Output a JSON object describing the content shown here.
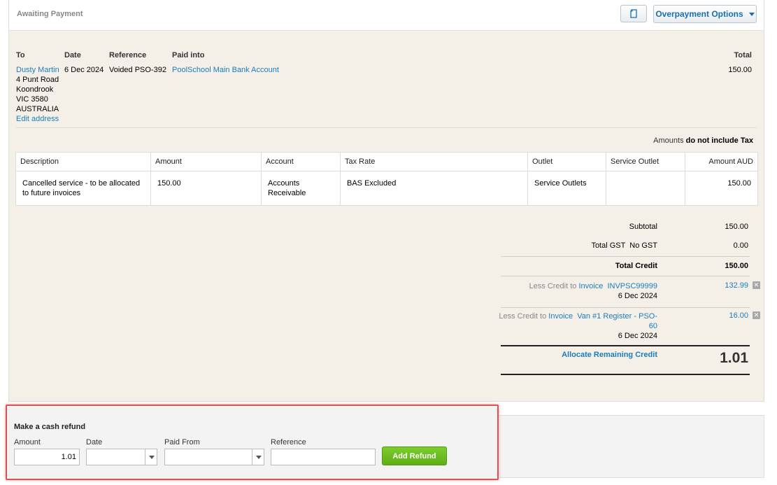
{
  "header": {
    "status": "Awaiting Payment",
    "overpayment_options_label": "Overpayment Options"
  },
  "details": {
    "labels": {
      "to": "To",
      "date": "Date",
      "reference": "Reference",
      "paid_into": "Paid into",
      "total": "Total"
    },
    "contact_name": "Dusty Martin",
    "address_lines": [
      "4 Punt Road",
      "Koondrook",
      "VIC 3580",
      "AUSTRALIA"
    ],
    "edit_address": "Edit address",
    "date": "6 Dec 2024",
    "reference": "Voided PSO-392",
    "paid_into": "PoolSchool Main Bank Account",
    "total": "150.00"
  },
  "amounts_note": {
    "prefix": "Amounts",
    "value": "do not include Tax"
  },
  "table": {
    "columns": [
      "Description",
      "Amount",
      "Account",
      "Tax Rate",
      "Outlet",
      "Service Outlet",
      "Amount AUD"
    ],
    "rows": [
      {
        "description": "Cancelled service - to be allocated to future invoices",
        "amount": "150.00",
        "account": "Accounts Receivable",
        "tax_rate": "BAS Excluded",
        "outlet": "Service Outlets",
        "service_outlet": "",
        "amount_aud": "150.00"
      }
    ]
  },
  "totals": {
    "subtotal_label": "Subtotal",
    "subtotal": "150.00",
    "gst_label": "Total GST  No GST",
    "gst": "0.00",
    "total_credit_label": "Total Credit",
    "total_credit": "150.00",
    "allocations": [
      {
        "prefix": "Less Credit to",
        "link_type": "Invoice",
        "link_ref": "INVPSC99999",
        "date": "6 Dec 2024",
        "amount": "132.99"
      },
      {
        "prefix": "Less Credit to",
        "link_type": "Invoice",
        "link_ref": "Van #1 Register - PSO-60",
        "date": "6 Dec 2024",
        "amount": "16.00"
      }
    ],
    "allocate_label": "Allocate Remaining Credit",
    "remaining": "1.01"
  },
  "refund": {
    "title": "Make a cash refund",
    "amount_label": "Amount",
    "amount_value": "1.01",
    "date_label": "Date",
    "date_value": "",
    "paid_from_label": "Paid From",
    "paid_from_value": "",
    "reference_label": "Reference",
    "reference_value": "",
    "add_refund_label": "Add Refund"
  },
  "colors": {
    "link": "#1a7cbf",
    "highlight_border": "#e05252",
    "button_green": "#6cbd22"
  },
  "icons": {
    "copy": "copy-icon",
    "dropdown": "chevron-down-icon",
    "remove": "remove-icon"
  }
}
